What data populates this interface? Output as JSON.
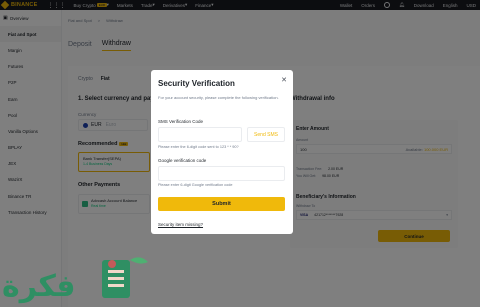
{
  "brand": {
    "name": "BINANCE"
  },
  "topnav": {
    "items": [
      "Buy Crypto",
      "Markets",
      "Trade",
      "Derivatives",
      "Finance"
    ],
    "buy_crypto_badge": "EUR",
    "right": {
      "wallet": "Wallet",
      "orders": "Orders",
      "download": "Download",
      "lang": "English",
      "currency": "USD"
    }
  },
  "sidebar": {
    "items": [
      "Overview",
      "Fiat and Spot",
      "Margin",
      "Futures",
      "P2P",
      "Earn",
      "Pool",
      "Vanilla Options",
      "BPLAY",
      "JEX",
      "WazirX",
      "Binance TR",
      "Transaction History"
    ]
  },
  "breadcrumb": [
    "Fiat and Spot",
    ">",
    "Withdraw"
  ],
  "tabs": [
    "Deposit",
    "Withdraw"
  ],
  "main": {
    "sub_tabs": [
      "Crypto",
      "Fiat"
    ],
    "step1": "1. Select currency and pay",
    "currency_label": "Currency",
    "currency_code": "EUR",
    "currency_name": "Euro",
    "recommended": "Recommended",
    "recommended_badge": "Hot",
    "bank_transfer": "Bank Transfer(SEPA)",
    "bank_transfer_sub": "1-4 Business Days",
    "other_payments": "Other Payments",
    "advcash": "Advcash Account Balance",
    "advcash_sub": "Real time"
  },
  "withdrawal_info": {
    "title": "Withdrawal info",
    "enter_amount": "Enter Amount",
    "amount_label": "Amount",
    "amount_value": "100",
    "available_label": "Available:",
    "available_value": "100.000 EUR",
    "fee_label": "Transaction Fee:",
    "fee_value": "2.00 EUR",
    "receive_label": "You Will Get:",
    "receive_value": "98.00 EUR",
    "beneficiary_title": "Beneficiary's Information",
    "withdraw_to_label": "Withdraw To",
    "card_brand": "VISA",
    "card_number": "421712*******7928",
    "continue": "Continue"
  },
  "modal": {
    "title": "Security Verification",
    "description": "For your account security, please complete the following verification.",
    "sms_label": "SMS Verification Code",
    "send_sms": "Send SMS",
    "sms_hint": "Please enter the 6-digit code sent to 123 * * 90?",
    "google_label": "Google verification code",
    "google_hint": "Please enter 6-digit Google verification code",
    "submit": "Submit",
    "missing_link": "Security item missing?"
  },
  "watermark": {
    "text": "فكرة"
  },
  "colors": {
    "accent": "#f0b90b",
    "topbar": "#181a20",
    "positive": "#0ecb81"
  }
}
